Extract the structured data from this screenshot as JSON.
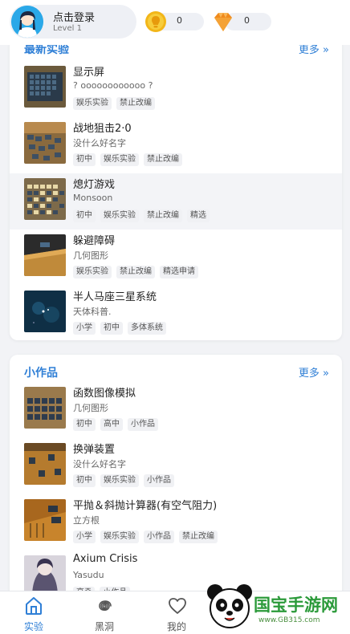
{
  "header": {
    "user_name": "点击登录",
    "level": "Level 1",
    "coins": "0",
    "gems": "0"
  },
  "section_latest": {
    "title": "最新实验",
    "more": "更多 »",
    "items": [
      {
        "title": "显示屏",
        "subtitle": "? oooooooooooo ?",
        "tags": [
          "娱乐实验",
          "禁止改编"
        ]
      },
      {
        "title": "战地狙击2·0",
        "subtitle": "没什么好名字",
        "tags": [
          "初中",
          "娱乐实验",
          "禁止改编"
        ]
      },
      {
        "title": "熄灯游戏",
        "subtitle": "Monsoon",
        "tags": [
          "初中",
          "娱乐实验",
          "禁止改编",
          "精选"
        ]
      },
      {
        "title": "躲避障碍",
        "subtitle": "几何图形",
        "tags": [
          "娱乐实验",
          "禁止改编",
          "精选申请"
        ]
      },
      {
        "title": "半人马座三星系统",
        "subtitle": "天体科普.",
        "tags": [
          "小学",
          "初中",
          "多体系统"
        ]
      }
    ]
  },
  "section_small": {
    "title": "小作品",
    "more": "更多 »",
    "items": [
      {
        "title": "函数图像模拟",
        "subtitle": "几何图形",
        "tags": [
          "初中",
          "高中",
          "小作品"
        ]
      },
      {
        "title": "换弹装置",
        "subtitle": "没什么好名字",
        "tags": [
          "初中",
          "娱乐实验",
          "小作品"
        ]
      },
      {
        "title": "平抛＆斜抛计算器(有空气阻力)",
        "subtitle": "立方根",
        "tags": [
          "小学",
          "娱乐实验",
          "小作品",
          "禁止改编"
        ]
      },
      {
        "title": "Axium Crisis",
        "subtitle": "Yasudu",
        "tags": [
          "高중",
          "小作品"
        ]
      }
    ]
  },
  "nav": {
    "items": [
      "实验",
      "黑洞",
      "我的"
    ]
  },
  "watermark": {
    "text": "国宝手游网",
    "url": "www.GB315.com"
  },
  "colors": {
    "accent": "#2f7fd6",
    "coin": "#f2b619",
    "gem": "#f08a1c"
  }
}
